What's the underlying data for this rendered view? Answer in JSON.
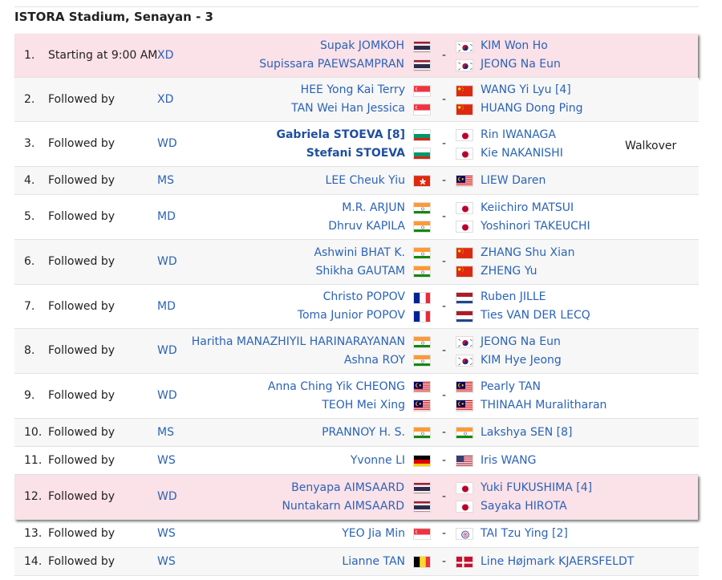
{
  "court_title": "ISTORA Stadium, Senayan - 3",
  "matches": [
    {
      "num": "1.",
      "schedule": "Starting at 9:00 AM",
      "event": "XD",
      "left": [
        {
          "name": "Supak JOMKOH",
          "flag": "THA",
          "bold": false
        },
        {
          "name": "Supissara PAEWSAMPRAN",
          "flag": "THA",
          "bold": false
        }
      ],
      "right": [
        {
          "name": "KIM Won Ho",
          "flag": "KOR"
        },
        {
          "name": "JEONG Na Eun",
          "flag": "KOR"
        }
      ],
      "note": "",
      "highlight": true
    },
    {
      "num": "2.",
      "schedule": "Followed by",
      "event": "XD",
      "left": [
        {
          "name": "HEE Yong Kai Terry",
          "flag": "SGP",
          "bold": false
        },
        {
          "name": "TAN Wei Han Jessica",
          "flag": "SGP",
          "bold": false
        }
      ],
      "right": [
        {
          "name": "WANG Yi Lyu [4]",
          "flag": "CHN"
        },
        {
          "name": "HUANG Dong Ping",
          "flag": "CHN"
        }
      ],
      "note": "",
      "highlight": false
    },
    {
      "num": "3.",
      "schedule": "Followed by",
      "event": "WD",
      "left": [
        {
          "name": "Gabriela STOEVA [8]",
          "flag": "BUL",
          "bold": true
        },
        {
          "name": "Stefani STOEVA",
          "flag": "BUL",
          "bold": true
        }
      ],
      "right": [
        {
          "name": "Rin IWANAGA",
          "flag": "JPN"
        },
        {
          "name": "Kie NAKANISHI",
          "flag": "JPN"
        }
      ],
      "note": "Walkover",
      "highlight": false
    },
    {
      "num": "4.",
      "schedule": "Followed by",
      "event": "MS",
      "left": [
        {
          "name": "LEE Cheuk Yiu",
          "flag": "HKG",
          "bold": false
        }
      ],
      "right": [
        {
          "name": "LIEW Daren",
          "flag": "MAS"
        }
      ],
      "note": "",
      "highlight": false
    },
    {
      "num": "5.",
      "schedule": "Followed by",
      "event": "MD",
      "left": [
        {
          "name": "M.R. ARJUN",
          "flag": "IND",
          "bold": false
        },
        {
          "name": "Dhruv KAPILA",
          "flag": "IND",
          "bold": false
        }
      ],
      "right": [
        {
          "name": "Keiichiro MATSUI",
          "flag": "JPN"
        },
        {
          "name": "Yoshinori TAKEUCHI",
          "flag": "JPN"
        }
      ],
      "note": "",
      "highlight": false
    },
    {
      "num": "6.",
      "schedule": "Followed by",
      "event": "WD",
      "left": [
        {
          "name": "Ashwini BHAT K.",
          "flag": "IND",
          "bold": false
        },
        {
          "name": "Shikha GAUTAM",
          "flag": "IND",
          "bold": false
        }
      ],
      "right": [
        {
          "name": "ZHANG Shu Xian",
          "flag": "CHN"
        },
        {
          "name": "ZHENG Yu",
          "flag": "CHN"
        }
      ],
      "note": "",
      "highlight": false
    },
    {
      "num": "7.",
      "schedule": "Followed by",
      "event": "MD",
      "left": [
        {
          "name": "Christo POPOV",
          "flag": "FRA",
          "bold": false
        },
        {
          "name": "Toma Junior POPOV",
          "flag": "FRA",
          "bold": false
        }
      ],
      "right": [
        {
          "name": "Ruben JILLE",
          "flag": "NED"
        },
        {
          "name": "Ties VAN DER LECQ",
          "flag": "NED"
        }
      ],
      "note": "",
      "highlight": false
    },
    {
      "num": "8.",
      "schedule": "Followed by",
      "event": "WD",
      "left": [
        {
          "name": "Haritha MANAZHIYIL HARINARAYANAN",
          "flag": "IND",
          "bold": false
        },
        {
          "name": "Ashna ROY",
          "flag": "IND",
          "bold": false
        }
      ],
      "right": [
        {
          "name": "JEONG Na Eun",
          "flag": "KOR"
        },
        {
          "name": "KIM Hye Jeong",
          "flag": "KOR"
        }
      ],
      "note": "",
      "highlight": false
    },
    {
      "num": "9.",
      "schedule": "Followed by",
      "event": "WD",
      "left": [
        {
          "name": "Anna Ching Yik CHEONG",
          "flag": "MAS",
          "bold": false
        },
        {
          "name": "TEOH Mei Xing",
          "flag": "MAS",
          "bold": false
        }
      ],
      "right": [
        {
          "name": "Pearly TAN",
          "flag": "MAS"
        },
        {
          "name": "THINAAH Muralitharan",
          "flag": "MAS"
        }
      ],
      "note": "",
      "highlight": false
    },
    {
      "num": "10.",
      "schedule": "Followed by",
      "event": "MS",
      "left": [
        {
          "name": "PRANNOY H. S.",
          "flag": "IND",
          "bold": false
        }
      ],
      "right": [
        {
          "name": "Lakshya SEN [8]",
          "flag": "IND"
        }
      ],
      "note": "",
      "highlight": false
    },
    {
      "num": "11.",
      "schedule": "Followed by",
      "event": "WS",
      "left": [
        {
          "name": "Yvonne LI",
          "flag": "GER",
          "bold": false
        }
      ],
      "right": [
        {
          "name": "Iris WANG",
          "flag": "USA"
        }
      ],
      "note": "",
      "highlight": false
    },
    {
      "num": "12.",
      "schedule": "Followed by",
      "event": "WD",
      "left": [
        {
          "name": "Benyapa AIMSAARD",
          "flag": "THA",
          "bold": false
        },
        {
          "name": "Nuntakarn AIMSAARD",
          "flag": "THA",
          "bold": false
        }
      ],
      "right": [
        {
          "name": "Yuki FUKUSHIMA [4]",
          "flag": "JPN"
        },
        {
          "name": "Sayaka HIROTA",
          "flag": "JPN"
        }
      ],
      "note": "",
      "highlight": true
    },
    {
      "num": "13.",
      "schedule": "Followed by",
      "event": "WS",
      "left": [
        {
          "name": "YEO Jia Min",
          "flag": "SGP",
          "bold": false
        }
      ],
      "right": [
        {
          "name": "TAI Tzu Ying [2]",
          "flag": "TPE"
        }
      ],
      "note": "",
      "highlight": false
    },
    {
      "num": "14.",
      "schedule": "Followed by",
      "event": "WS",
      "left": [
        {
          "name": "Lianne TAN",
          "flag": "BEL",
          "bold": false
        }
      ],
      "right": [
        {
          "name": "Line Højmark KJAERSFELDT",
          "flag": "DEN"
        }
      ],
      "note": "",
      "highlight": false
    }
  ]
}
